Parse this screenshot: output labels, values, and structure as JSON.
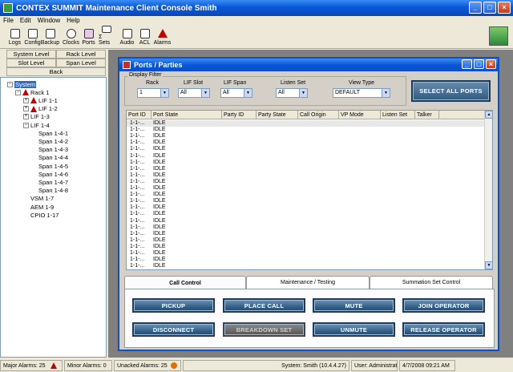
{
  "app": {
    "title": "CONTEX SUMMIT Maintenance Client Console Smith"
  },
  "menu": [
    "File",
    "Edit",
    "Window",
    "Help"
  ],
  "toolbar": [
    {
      "label": "Logs",
      "icon": "logs-icon"
    },
    {
      "label": "Config",
      "icon": "config-icon"
    },
    {
      "label": "Backup",
      "icon": "backup-icon"
    },
    {
      "label": "Clocks",
      "icon": "clock-icon"
    },
    {
      "label": "Ports",
      "icon": "ports-icon"
    },
    {
      "label": "Σ Sets",
      "icon": "sum-sets-icon"
    },
    {
      "label": "Audio",
      "icon": "speaker-icon"
    },
    {
      "label": "ACL",
      "icon": "acl-icon"
    },
    {
      "label": "Alarms",
      "icon": "alarm-icon"
    }
  ],
  "levels": {
    "system": "System Level",
    "rack": "Rack Level",
    "slot": "Slot Level",
    "span": "Span Level",
    "back": "Back"
  },
  "tree": [
    {
      "label": "System",
      "depth": 0,
      "expander": "−",
      "selected": true
    },
    {
      "label": "Rack 1",
      "depth": 1,
      "expander": "−",
      "alarm": true
    },
    {
      "label": "LIF 1-1",
      "depth": 2,
      "expander": "+",
      "alarm": true
    },
    {
      "label": "LIF 1-2",
      "depth": 2,
      "expander": "+",
      "alarm": true
    },
    {
      "label": "LIF 1-3",
      "depth": 2,
      "expander": "+"
    },
    {
      "label": "LIF 1-4",
      "depth": 2,
      "expander": "−"
    },
    {
      "label": "Span 1-4-1",
      "depth": 3
    },
    {
      "label": "Span 1-4-2",
      "depth": 3
    },
    {
      "label": "Span 1-4-3",
      "depth": 3
    },
    {
      "label": "Span 1-4-4",
      "depth": 3
    },
    {
      "label": "Span 1-4-5",
      "depth": 3
    },
    {
      "label": "Span 1-4-6",
      "depth": 3
    },
    {
      "label": "Span 1-4-7",
      "depth": 3
    },
    {
      "label": "Span 1-4-8",
      "depth": 3
    },
    {
      "label": "VSM 1-7",
      "depth": 2
    },
    {
      "label": "AEM 1-9",
      "depth": 2
    },
    {
      "label": "CPIO 1-17",
      "depth": 2
    }
  ],
  "window": {
    "title": "Ports / Parties"
  },
  "filter": {
    "legend": "Display Filter",
    "rack": {
      "label": "Rack",
      "value": "1"
    },
    "lif_slot": {
      "label": "LIF Slot",
      "value": "All"
    },
    "lif_span": {
      "label": "LIF Span",
      "value": "All"
    },
    "listen_set": {
      "label": "Listen Set",
      "value": "All"
    },
    "view_type": {
      "label": "View Type",
      "value": "DEFAULT"
    }
  },
  "select_all": "SELECT ALL PORTS",
  "grid": {
    "columns": [
      "Port ID",
      "Port State",
      "Party ID",
      "Party State",
      "Call Origin",
      "VP Mode",
      "Listen Set",
      "Talker"
    ],
    "rows": [
      [
        "1-1-...",
        "IDLE"
      ],
      [
        "1-1-...",
        "IDLE"
      ],
      [
        "1-1-...",
        "IDLE"
      ],
      [
        "1-1-...",
        "IDLE"
      ],
      [
        "1-1-...",
        "IDLE"
      ],
      [
        "1-1-...",
        "IDLE"
      ],
      [
        "1-1-...",
        "IDLE"
      ],
      [
        "1-1-...",
        "IDLE"
      ],
      [
        "1-1-...",
        "IDLE"
      ],
      [
        "1-1-...",
        "IDLE"
      ],
      [
        "1-1-...",
        "IDLE"
      ],
      [
        "1-1-...",
        "IDLE"
      ],
      [
        "1-1-...",
        "IDLE"
      ],
      [
        "1-1-...",
        "IDLE"
      ],
      [
        "1-1-...",
        "IDLE"
      ],
      [
        "1-1-...",
        "IDLE"
      ],
      [
        "1-1-...",
        "IDLE"
      ],
      [
        "1-1-...",
        "IDLE"
      ],
      [
        "1-1-...",
        "IDLE"
      ],
      [
        "1-1-...",
        "IDLE"
      ],
      [
        "1-1-...",
        "IDLE"
      ],
      [
        "1-1-...",
        "IDLE"
      ],
      [
        "1-1-...",
        "IDLE"
      ]
    ]
  },
  "tabs": [
    "Call Control",
    "Maintenance / Testing",
    "Summation Set Control"
  ],
  "buttons": [
    {
      "label": "PICKUP",
      "enabled": true
    },
    {
      "label": "PLACE CALL",
      "enabled": true
    },
    {
      "label": "MUTE",
      "enabled": true
    },
    {
      "label": "JOIN OPERATOR",
      "enabled": true
    },
    {
      "label": "DISCONNECT",
      "enabled": true
    },
    {
      "label": "BREAKDOWN SET",
      "enabled": false
    },
    {
      "label": "UNMUTE",
      "enabled": true
    },
    {
      "label": "RELEASE OPERATOR",
      "enabled": true
    }
  ],
  "status": {
    "major": "Major Alarms: 25",
    "minor": "Minor Alarms: 0",
    "unacked": "Unacked Alarms: 25",
    "system": "System: Smith (10.4.4.27)",
    "user": "User: Administrator",
    "datetime": "4/7/2008 09:21 AM"
  },
  "colors": {
    "title_blue": "#0a57d6",
    "button_blue": "#2f5a80",
    "alarm_red": "#c00000",
    "selection": "#316ac5"
  }
}
